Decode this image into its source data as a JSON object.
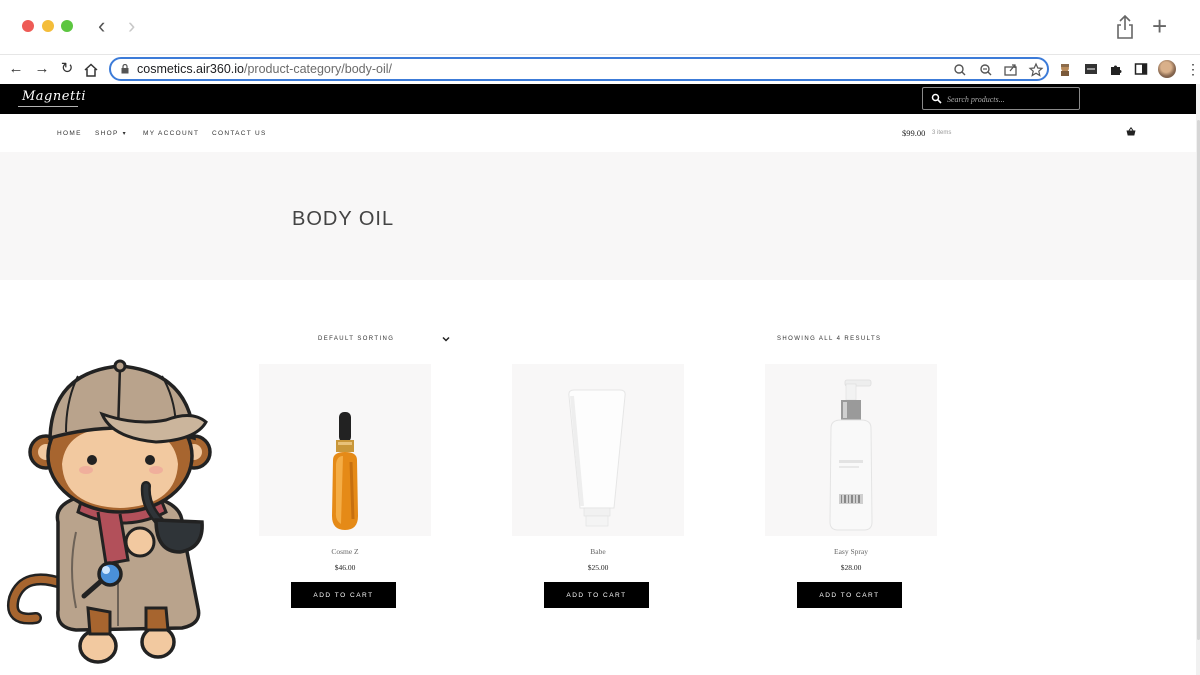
{
  "browser": {
    "url_host": "cosmetics.air360.io",
    "url_path": "/product-category/body-oil/"
  },
  "site": {
    "logo_text": "Magnetti",
    "search": {
      "placeholder": "Search products..."
    },
    "nav": {
      "home": "HOME",
      "shop": "SHOP",
      "account": "MY ACCOUNT",
      "contact": "CONTACT US"
    },
    "cart": {
      "total": "$99.00",
      "count": "3 items"
    }
  },
  "page": {
    "title": "BODY OIL",
    "sorting_label": "DEFAULT SORTING",
    "results_label": "SHOWING ALL 4 RESULTS"
  },
  "products": [
    {
      "name": "Cosme Z",
      "price": "$46.00",
      "button": "ADD TO CART"
    },
    {
      "name": "Babe",
      "price": "$25.00",
      "button": "ADD TO CART"
    },
    {
      "name": "Easy Spray",
      "price": "$28.00",
      "button": "ADD TO CART"
    }
  ],
  "colors": {
    "accent_url": "#3c7bd8",
    "header_bg": "#000000",
    "hero_bg": "#f8f7f7",
    "button_bg": "#000000"
  },
  "icons": [
    "back-icon",
    "forward-icon",
    "reload-icon",
    "home-icon",
    "lock-icon",
    "zoom-icon",
    "share-icon",
    "star-icon",
    "extensions-icon",
    "sidebar-icon",
    "search-icon",
    "basket-icon",
    "chevron-down-icon"
  ]
}
